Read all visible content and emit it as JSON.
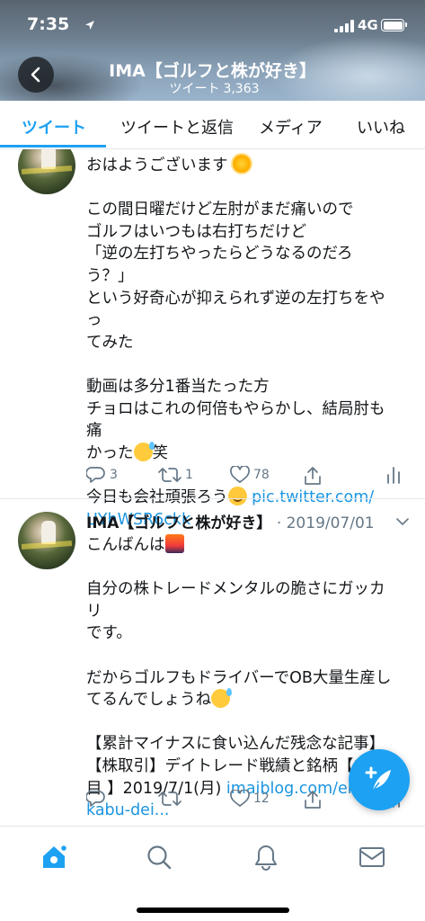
{
  "status_bar": {
    "time": "7:35",
    "network": "4G",
    "icons": [
      "location-arrow-icon",
      "signal-icon",
      "battery-icon"
    ]
  },
  "header": {
    "back_icon": "chevron-left-icon",
    "profile_name": "IMA【ゴルフと株が好き】",
    "tweet_count_label": "ツイート",
    "tweet_count": "3,363"
  },
  "tabs": [
    {
      "label": "ツイート",
      "active": true
    },
    {
      "label": "ツイートと返信",
      "active": false
    },
    {
      "label": "メディア",
      "active": false
    },
    {
      "label": "いいね",
      "active": false
    }
  ],
  "tweets": [
    {
      "partial": true,
      "lines": {
        "l1": "おはようございます",
        "l2": "この間日曜だけど左肘がまだ痛いので",
        "l3": "ゴルフはいつもは右打ちだけど",
        "l4": "「逆の左打ちやったらどうなるのだろう？」",
        "l5": "という好奇心が抑えられず逆の左打ちをやっ",
        "l6": "てみた",
        "l7": "動画は多分1番当たった方",
        "l8": "チョロはこれの何倍もやらかし、結局肘も痛",
        "l9a": "かった",
        "l9b": "笑",
        "l10": "今日も会社頑張ろう",
        "link1": "pic.twitter.com/",
        "link2": "UYhWSR6ckk"
      },
      "actions": {
        "replies": "3",
        "retweets": "1",
        "likes": "78"
      }
    },
    {
      "author": "IMA【ゴルフと株が好き】",
      "date": "· 2019/07/01",
      "lines": {
        "l1": "こんばんは",
        "l2": "自分の株トレードメンタルの脆さにガッカリ",
        "l3": "です。",
        "l4": "だからゴルフもドライバーでOB大量生産し",
        "l5": "てるんでしょうね",
        "l6": "【累計マイナスに食い込んだ残念な記事】",
        "l7": "【株取引】デイトレード戦績と銘柄【9日",
        "l8": "目 】2019/7/1(月)",
        "link1": "imaiblog.com/ent",
        "link2": "kabu-dei..."
      },
      "actions": {
        "replies": "",
        "retweets": "",
        "likes": "12"
      }
    }
  ],
  "fab": {
    "icon": "compose-tweet-icon"
  },
  "bottom_nav": [
    "home-icon",
    "search-icon",
    "notifications-bell-icon",
    "messages-envelope-icon"
  ],
  "colors": {
    "accent": "#1da1f2",
    "link": "#1b95e0",
    "muted": "#657786",
    "divider": "#e1e8ed"
  }
}
